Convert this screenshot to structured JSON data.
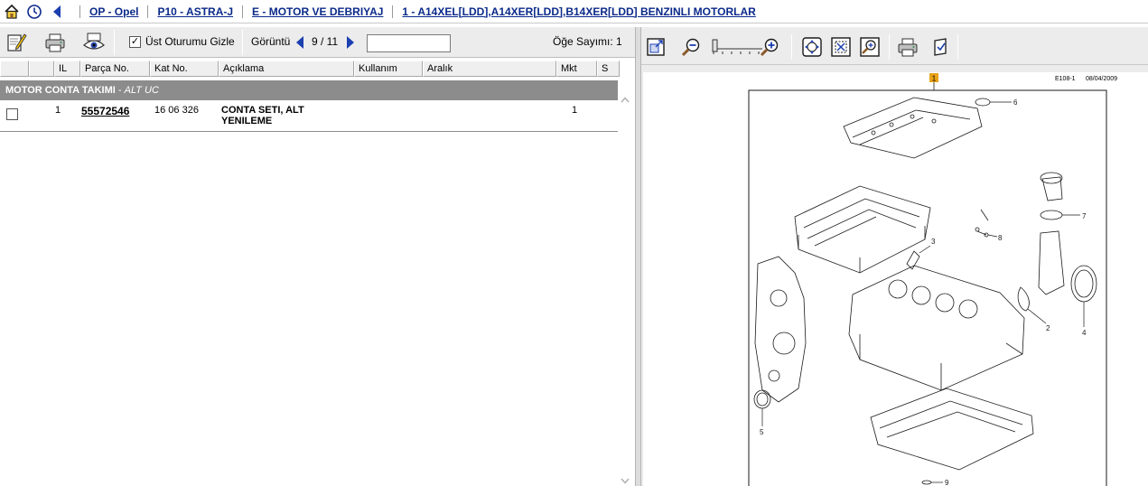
{
  "breadcrumb": {
    "items": [
      {
        "label": "OP - Opel"
      },
      {
        "label": "P10 - ASTRA-J"
      },
      {
        "label": "E - MOTOR VE DEBRIYAJ"
      },
      {
        "label": "1 - A14XEL[LDD],A14XER[LDD],B14XER[LDD] BENZINLI MOTORLAR"
      }
    ]
  },
  "left_toolbar": {
    "hide_header_label": "Üst Oturumu Gizle",
    "hide_header_checked": "✓",
    "view_label": "Görüntü",
    "view_page": "9 / 11",
    "page_input_value": "",
    "item_count_label": "Öğe Sayımı: 1"
  },
  "table": {
    "columns": [
      "",
      "",
      "IL",
      "Parça No.",
      "Kat No.",
      "Açıklama",
      "Kullanım",
      "Aralık",
      "Mkt",
      "S"
    ],
    "group": {
      "name": "MOTOR CONTA TAKIMI",
      "sub": "ALT UC"
    },
    "rows": [
      {
        "il": "1",
        "part_no": "55572546",
        "kat_no": "16 06 326",
        "desc_line1": "CONTA SETI, ALT",
        "desc_line2": "YENILEME",
        "usage": "",
        "range": "",
        "qty": "1",
        "s": ""
      }
    ]
  },
  "diagram": {
    "ref_badge": "1",
    "code": "E108-1",
    "date": "08/04/2009",
    "callouts": [
      "6",
      "7",
      "8",
      "3",
      "2",
      "4",
      "5",
      "9"
    ]
  },
  "icons": {
    "home": "home-icon",
    "history": "clock-icon",
    "back": "back-arrow-icon",
    "edit": "notepad-edit-icon",
    "print": "printer-icon",
    "preview": "eye-preview-icon",
    "fit": "fit-window-icon",
    "zoom_out": "zoom-out-icon",
    "zoom_in": "zoom-in-icon",
    "pan": "pan-icon",
    "zoom_area": "zoom-area-icon",
    "zoom_select": "zoom-select-icon",
    "print_image": "printer-icon",
    "export": "export-icon"
  },
  "colors": {
    "link": "#0b2a8a",
    "group_bg": "#8c8c8c",
    "toolbar_bg": "#ececec",
    "badge": "#e8a317"
  }
}
